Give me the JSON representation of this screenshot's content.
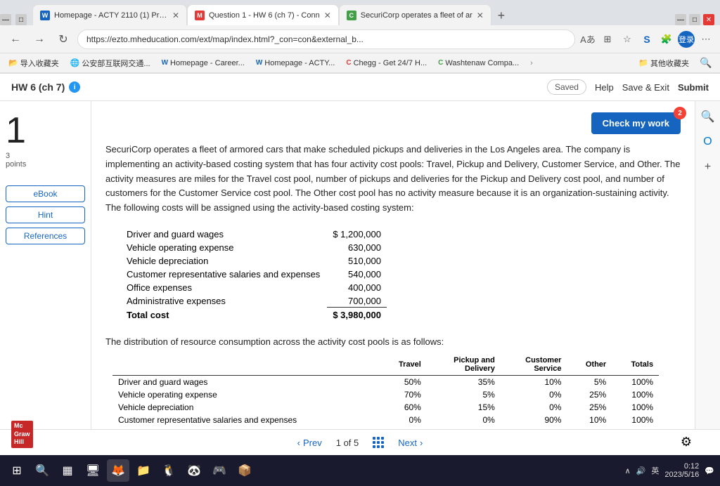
{
  "browser": {
    "tabs": [
      {
        "id": "tab1",
        "favicon_color": "#1565C0",
        "favicon_letter": "W",
        "title": "Homepage - ACTY 2110 (1) Princ",
        "active": false
      },
      {
        "id": "tab2",
        "favicon_color": "#e53935",
        "favicon_letter": "M",
        "title": "Question 1 - HW 6 (ch 7) - Conn",
        "active": true
      },
      {
        "id": "tab3",
        "favicon_color": "#43a047",
        "favicon_letter": "C",
        "title": "SecuriCorp operates a fleet of ar",
        "active": false
      }
    ],
    "new_tab_label": "+",
    "address": "https://ezto.mheducation.com/ext/map/index.html?_con=con&external_b...",
    "bookmarks": [
      {
        "label": "导入收藏夹"
      },
      {
        "label": "公安部互联网交通..."
      },
      {
        "label": "Homepage - Career..."
      },
      {
        "label": "Homepage - ACTY..."
      },
      {
        "label": "Chegg - Get 24/7 H..."
      },
      {
        "label": "Washtenaw Compa..."
      },
      {
        "label": "其他收藏夹"
      }
    ]
  },
  "app_header": {
    "title": "HW 6 (ch 7)",
    "info_label": "i",
    "saved_label": "Saved",
    "help_label": "Help",
    "save_exit_label": "Save & Exit",
    "submit_label": "Submit"
  },
  "sidebar": {
    "question_number": "1",
    "points": "3",
    "points_label": "points",
    "links": [
      {
        "label": "eBook"
      },
      {
        "label": "Hint"
      },
      {
        "label": "References"
      }
    ]
  },
  "question": {
    "check_btn_label": "Check my work",
    "notification_count": "2",
    "text": "SecuriCorp operates a fleet of armored cars that make scheduled pickups and deliveries in the Los Angeles area. The company is implementing an activity-based costing system that has four activity cost pools: Travel, Pickup and Delivery, Customer Service, and Other. The activity measures are miles for the Travel cost pool, number of pickups and deliveries for the Pickup and Delivery cost pool, and number of customers for the Customer Service cost pool. The Other cost pool has no activity measure because it is an organization-sustaining activity. The following costs will be assigned using the activity-based costing system:",
    "costs": [
      {
        "label": "Driver and guard wages",
        "value": "$ 1,200,000"
      },
      {
        "label": "Vehicle operating expense",
        "value": "630,000"
      },
      {
        "label": "Vehicle depreciation",
        "value": "510,000"
      },
      {
        "label": "Customer representative salaries and expenses",
        "value": "540,000"
      },
      {
        "label": "Office expenses",
        "value": "400,000"
      },
      {
        "label": "Administrative expenses",
        "value": "700,000"
      }
    ],
    "total_label": "Total cost",
    "total_value": "$ 3,980,000",
    "distribution_text": "The distribution of resource consumption across the activity cost pools is as follows:",
    "dist_headers": [
      "Travel",
      "Pickup and\nDelivery",
      "Customer\nService",
      "Other",
      "Totals"
    ],
    "dist_rows": [
      {
        "label": "Driver and guard wages",
        "travel": "50%",
        "pickup": "35%",
        "customer": "10%",
        "other": "5%",
        "total": "100%"
      },
      {
        "label": "Vehicle operating expense",
        "travel": "70%",
        "pickup": "5%",
        "customer": "0%",
        "other": "25%",
        "total": "100%"
      },
      {
        "label": "Vehicle depreciation",
        "travel": "60%",
        "pickup": "15%",
        "customer": "0%",
        "other": "25%",
        "total": "100%"
      },
      {
        "label": "Customer representative salaries and expenses",
        "travel": "0%",
        "pickup": "0%",
        "customer": "90%",
        "other": "10%",
        "total": "100%"
      }
    ]
  },
  "pagination": {
    "prev_label": "Prev",
    "next_label": "Next",
    "current": "1",
    "separator": "of",
    "total": "5"
  },
  "right_panel": {
    "icons": [
      "🌐",
      "📅",
      "+"
    ]
  },
  "taskbar": {
    "icons": [
      "⊞",
      "🔍",
      "▦",
      "🖥",
      "🦊",
      "📁",
      "🐧",
      "🐼",
      "🎮",
      "📦"
    ],
    "system_tray": {
      "lang": "英",
      "time": "0:12",
      "date": "2023/5/16"
    }
  },
  "mcgraw": {
    "line1": "Mc",
    "line2": "Graw",
    "line3": "Hill"
  }
}
